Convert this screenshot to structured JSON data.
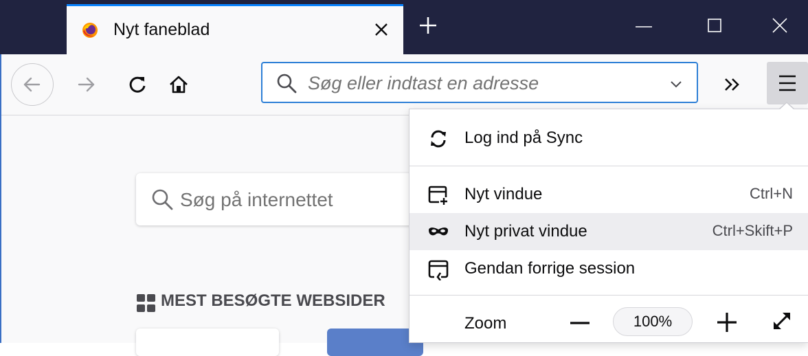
{
  "tab": {
    "title": "Nyt faneblad"
  },
  "urlbar": {
    "placeholder": "Søg eller indtast en adresse"
  },
  "content": {
    "search_placeholder": "Søg på internettet",
    "topsites_title": "MEST BESØGTE WEBSIDER"
  },
  "menu": {
    "items": [
      {
        "label": "Log ind på Sync",
        "shortcut": ""
      },
      {
        "label": "Nyt vindue",
        "shortcut": "Ctrl+N"
      },
      {
        "label": "Nyt privat vindue",
        "shortcut": "Ctrl+Skift+P"
      },
      {
        "label": "Gendan forrige session",
        "shortcut": ""
      }
    ],
    "zoom": {
      "label": "Zoom",
      "value": "100%"
    }
  },
  "colors": {
    "titlebar": "#202340",
    "accent": "#0a84ff",
    "urlbar_border": "#2d7fd6"
  }
}
